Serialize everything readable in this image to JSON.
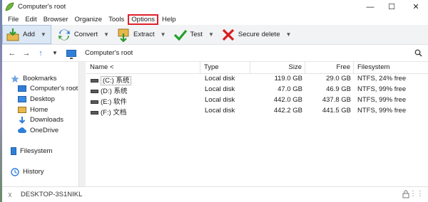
{
  "window": {
    "title": "Computer's root"
  },
  "menubar": {
    "items": [
      "File",
      "Edit",
      "Browser",
      "Organize",
      "Tools",
      "Options",
      "Help"
    ],
    "highlighted": "Options"
  },
  "toolbar": {
    "add_label": "Add",
    "convert_label": "Convert",
    "extract_label": "Extract",
    "test_label": "Test",
    "secure_delete_label": "Secure delete"
  },
  "addressbar": {
    "path": "Computer's root"
  },
  "sidebar": {
    "bookmarks_label": "Bookmarks",
    "items": [
      "Computer's root",
      "Desktop",
      "Home",
      "Downloads",
      "OneDrive"
    ],
    "filesystem_label": "Filesystem",
    "history_label": "History"
  },
  "filelist": {
    "headers": {
      "name": "Name <",
      "type": "Type",
      "size": "Size",
      "free": "Free",
      "filesystem": "Filesystem"
    },
    "rows": [
      {
        "name": "(C:) 系统",
        "type": "Local disk",
        "size": "119.0 GB",
        "free": "29.0 GB",
        "filesystem": "NTFS, 24% free"
      },
      {
        "name": "(D:) 系统",
        "type": "Local disk",
        "size": "47.0 GB",
        "free": "46.9 GB",
        "filesystem": "NTFS, 99% free"
      },
      {
        "name": "(E:) 软件",
        "type": "Local disk",
        "size": "442.0 GB",
        "free": "437.8 GB",
        "filesystem": "NTFS, 99% free"
      },
      {
        "name": "(F:) 文档",
        "type": "Local disk",
        "size": "442.2 GB",
        "free": "441.5 GB",
        "filesystem": "NTFS, 99% free"
      }
    ]
  },
  "statusbar": {
    "computer_name": "DESKTOP-3S1NIKL"
  },
  "colors": {
    "highlight_border": "#e0202a",
    "accent_blue": "#2f7fd8",
    "toolbar_bg": "#f2f3f5"
  }
}
